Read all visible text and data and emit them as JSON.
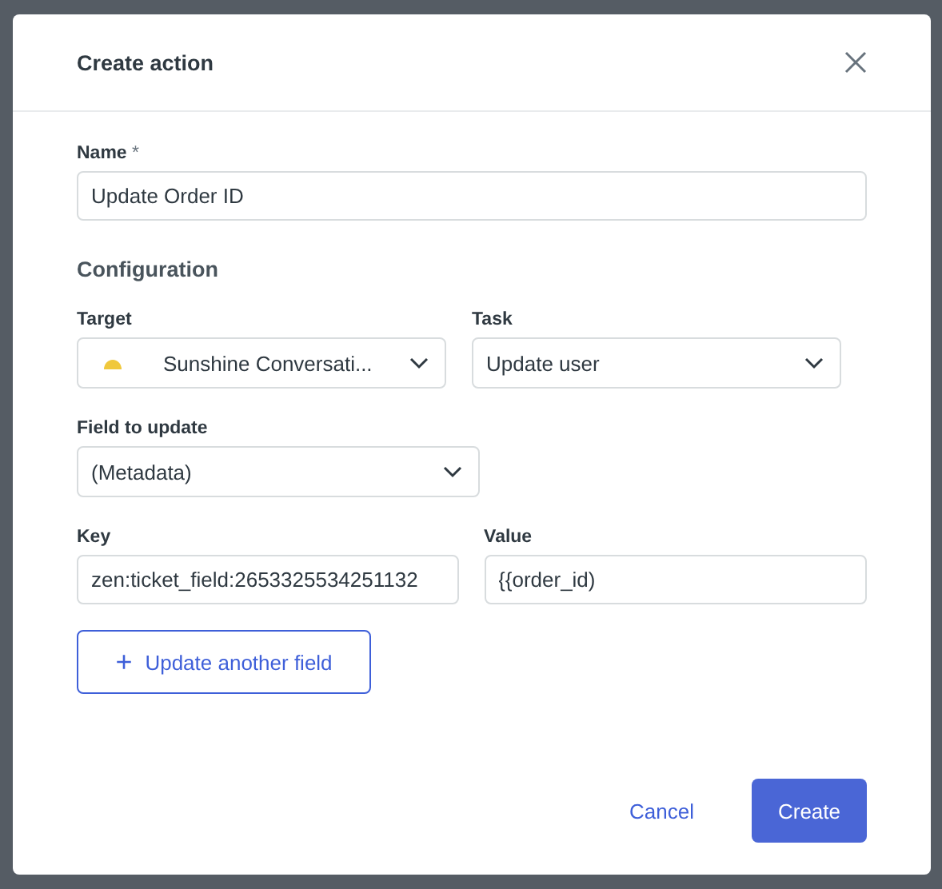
{
  "dialog": {
    "title": "Create action"
  },
  "name_field": {
    "label": "Name",
    "required_mark": "*",
    "value": "Update Order ID"
  },
  "section_title": "Configuration",
  "target": {
    "label": "Target",
    "value": "Sunshine Conversati..."
  },
  "task": {
    "label": "Task",
    "value": "Update user"
  },
  "field_to_update": {
    "label": "Field to update",
    "value": "(Metadata)"
  },
  "key": {
    "label": "Key",
    "value": "zen:ticket_field:2653325534251132"
  },
  "value": {
    "label": "Value",
    "value": "{{order_id)"
  },
  "add_button": {
    "icon": "+",
    "label": "Update another field"
  },
  "buttons": [
    {
      "kind": "link",
      "label": "Cancel"
    },
    {
      "kind": "primary",
      "label": "Create"
    }
  ]
}
